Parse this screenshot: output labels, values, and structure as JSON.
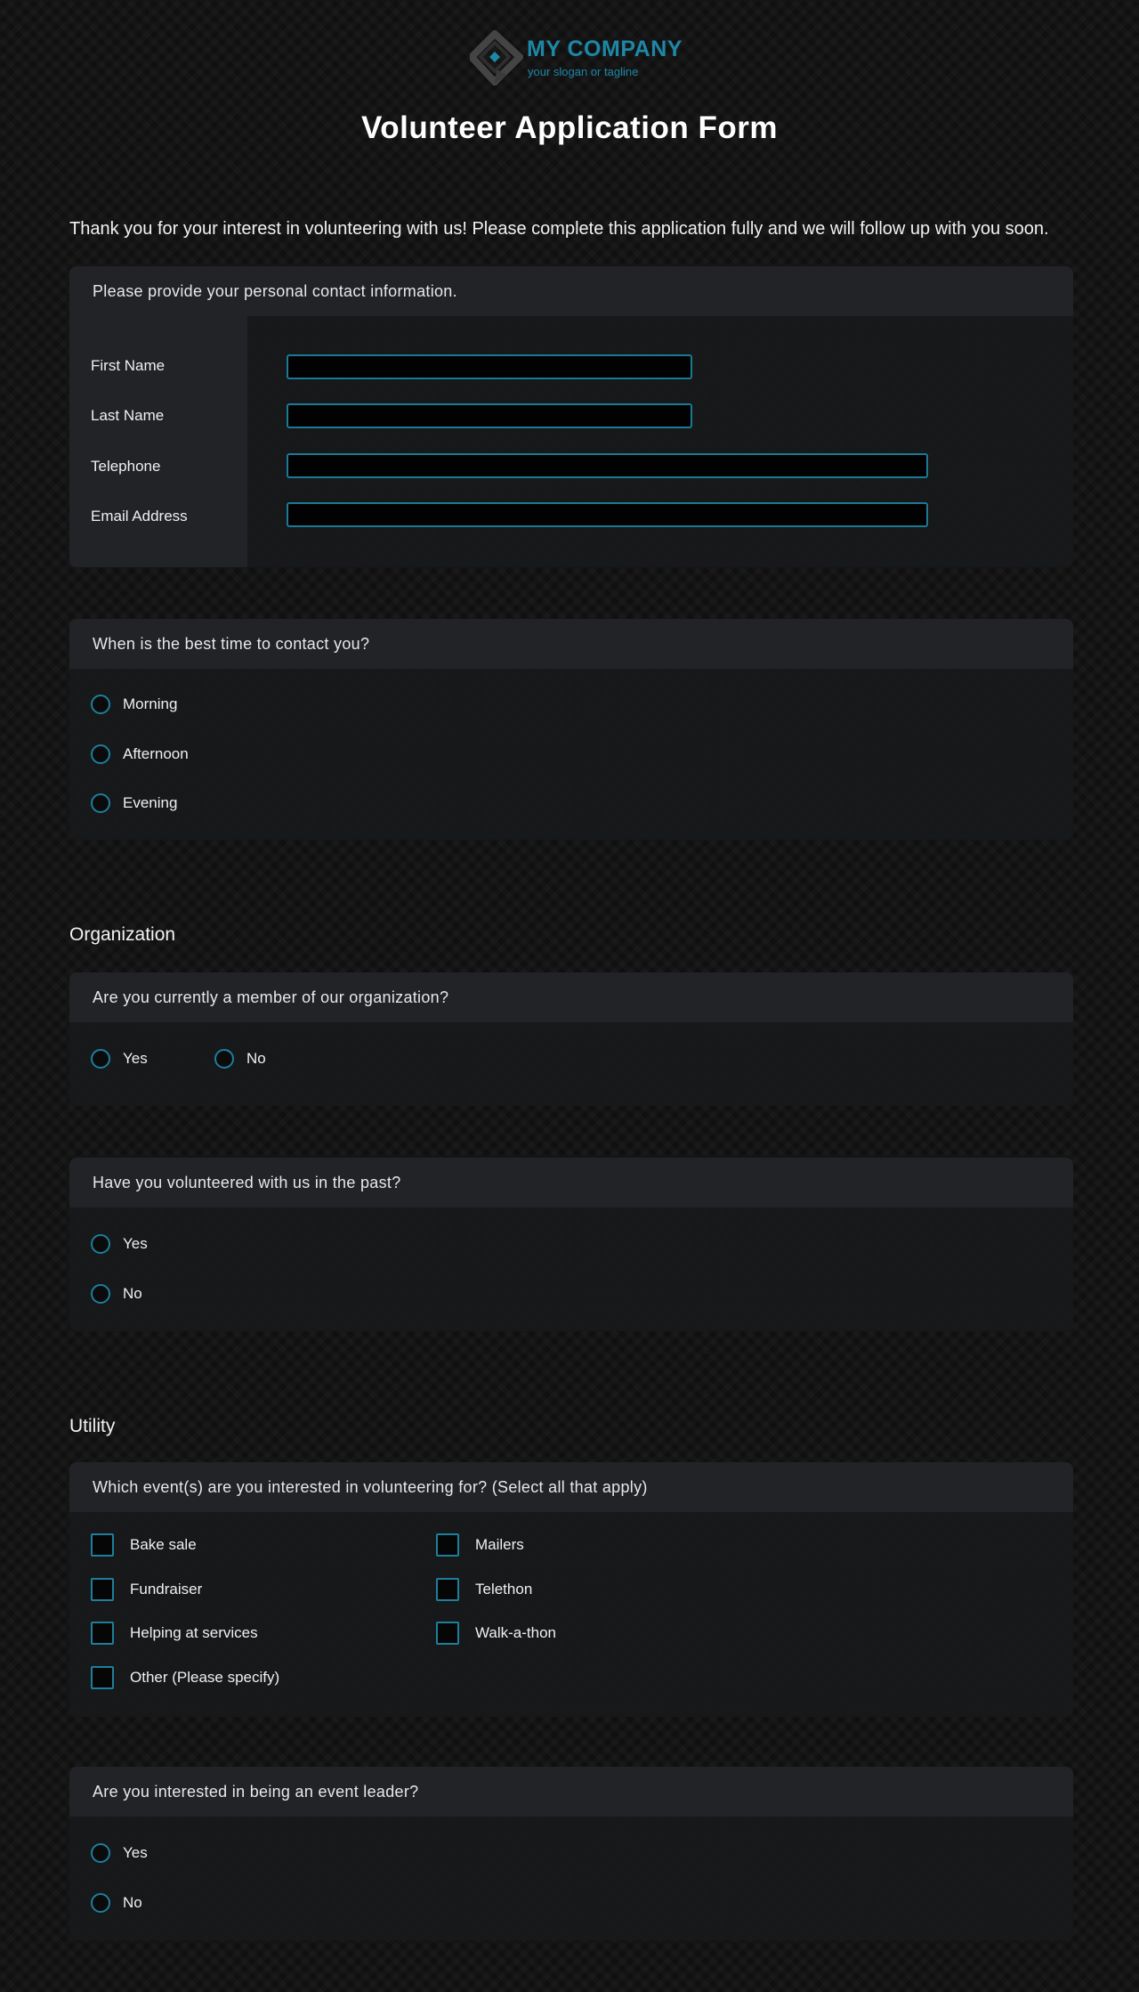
{
  "header": {
    "company_name": "MY COMPANY",
    "tagline": "your slogan or tagline",
    "logo_icon": "diamond-logo-icon",
    "title": "Volunteer Application Form"
  },
  "intro": "Thank you for your interest in volunteering with us! Please complete this application fully and we will follow up with you soon.",
  "contact": {
    "heading": "Please provide your personal contact information.",
    "fields": [
      {
        "label": "First Name",
        "value": ""
      },
      {
        "label": "Last Name",
        "value": ""
      },
      {
        "label": "Telephone",
        "value": ""
      },
      {
        "label": "Email Address",
        "value": ""
      }
    ]
  },
  "best_time": {
    "question": "When is the best time to contact you?",
    "options": [
      "Morning",
      "Afternoon",
      "Evening"
    ]
  },
  "organization": {
    "heading": "Organization",
    "member": {
      "question": "Are you currently a member of our organization?",
      "options": [
        "Yes",
        "No"
      ]
    },
    "past": {
      "question": "Have you volunteered with us in the past?",
      "options": [
        "Yes",
        "No"
      ]
    }
  },
  "utility": {
    "heading": "Utility",
    "events": {
      "question": "Which event(s) are you interested in volunteering for? (Select all that apply)",
      "options": [
        "Bake sale",
        "Mailers",
        "Fundraiser",
        "Telethon",
        "Helping at services",
        "Walk-a-thon",
        "Other (Please specify)"
      ]
    },
    "leader": {
      "question": "Are you interested in being an event leader?",
      "options": [
        "Yes",
        "No"
      ]
    }
  },
  "colors": {
    "accent": "#1d87a6",
    "background": "#101010",
    "card_header": "#212327"
  }
}
